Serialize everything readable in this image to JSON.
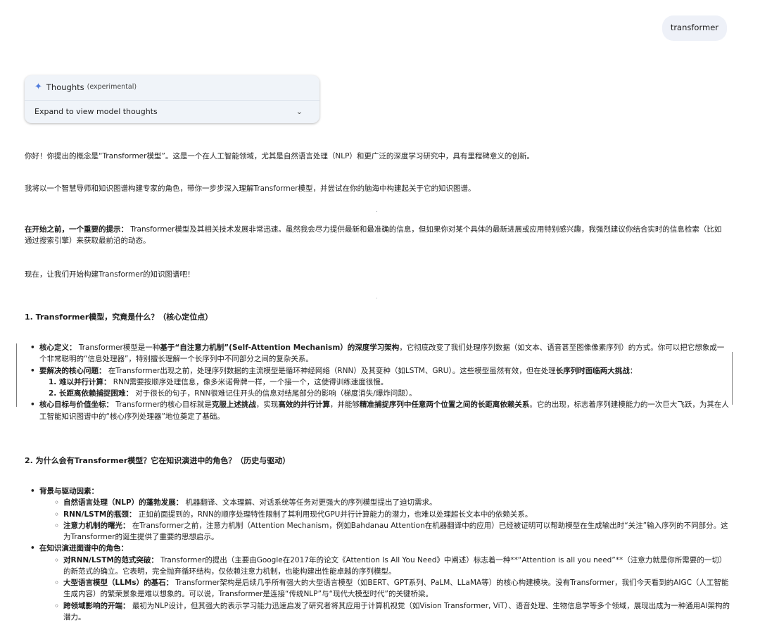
{
  "user_query": "transformer",
  "thoughts": {
    "title": "Thoughts",
    "tag": "(experimental)",
    "expand_label": "Expand to view model thoughts"
  },
  "response": {
    "p1": "你好！你提出的概念是“Transformer模型”。这是一个在人工智能领域，尤其是自然语言处理（NLP）和更广泛的深度学习研究中，具有里程碑意义的创新。",
    "p2": "我将以一个智慧导师和知识图谱构建专家的角色，带你一步步深入理解Transformer模型，并尝试在你的脑海中构建起关于它的知识图谱。",
    "p3_bold": "在开始之前，一个重要的提示：",
    "p3_text": " Transformer模型及其相关技术发展非常迅速。虽然我会尽力提供最新和最准确的信息，但如果你对某个具体的最新进展或应用特别感兴趣，我强烈建议你结合实时的信息检索（比如通过搜索引擎）来获取最前沿的动态。",
    "p4": "现在，让我们开始构建Transformer的知识图谱吧！",
    "section1": {
      "heading": "1. Transformer模型，究竟是什么？（核心定位点）",
      "b1_label": "核心定义：",
      "b1_t1": " Transformer模型是一种",
      "b1_bold2": "基于“自注意力机制”(Self-Attention Mechanism）的深度学习架构",
      "b1_t2": "，它彻底改变了我们处理序列数据（如文本、语音甚至图像像素序列）的方式。你可以把它想象成一个非常聪明的“信息处理器”，特别擅长理解一个长序列中不同部分之间的复杂关系。",
      "b2_label": "要解决的核心问题：",
      "b2_t1": " 在Transformer出现之前，处理序列数据的主流模型是循环神经网络（RNN）及其变种（如LSTM、GRU）。这些模型虽然有效，但在处理",
      "b2_bold2": "长序列时面临两大挑战",
      "b2_t2": "：",
      "n1_label": "1. 难以并行计算：",
      "n1_text": " RNN需要按顺序处理信息，像多米诺骨牌一样，一个接一个，这使得训练速度很慢。",
      "n2_label": "2. 长距离依赖捕捉困难：",
      "n2_text": " 对于很长的句子，RNN很难记住开头的信息对结尾部分的影响（梯度消失/爆炸问题）。",
      "b3_label": "核心目标与价值坐标：",
      "b3_t1": " Transformer的核心目标就是",
      "b3_bold2": "克服上述挑战",
      "b3_t2": "，实现",
      "b3_bold3": "高效的并行计算",
      "b3_t3": "，并能够",
      "b3_bold4": "精准捕捉序列中任意两个位置之间的长距离依赖关系",
      "b3_t4": "。它的出现，标志着序列建模能力的一次巨大飞跃，为其在人工智能知识图谱中的“核心序列处理器”地位奠定了基础。"
    },
    "section2": {
      "heading": "2. 为什么会有Transformer模型？它在知识演进中的角色？（历史与驱动）",
      "g1_label": "背景与驱动因素：",
      "s1_label": "自然语言处理（NLP）的蓬勃发展：",
      "s1_text": " 机器翻译、文本理解、对话系统等任务对更强大的序列模型提出了迫切需求。",
      "s2_label": "RNN/LSTM的瓶颈：",
      "s2_text": " 正如前面提到的，RNN的顺序处理特性限制了其利用现代GPU并行计算能力的潜力，也难以处理超长文本中的依赖关系。",
      "s3_label": "注意力机制的曙光：",
      "s3_text": " 在Transformer之前，注意力机制（Attention Mechanism，例如Bahdanau Attention在机器翻译中的应用）已经被证明可以帮助模型在生成输出时“关注”输入序列的不同部分。这为Transformer的诞生提供了重要的思想启示。",
      "g2_label": "在知识演进图谱中的角色：",
      "r1_label": "对RNN/LSTM的范式突破：",
      "r1_text": " Transformer的提出（主要由Google在2017年的论文《Attention Is All You Need》中阐述）标志着一种**“Attention is all you need”**（注意力就是你所需要的一切）的新范式的确立。它表明，完全抛弃循环结构，仅依赖注意力机制，也能构建出性能卓越的序列模型。",
      "r2_label": "大型语言模型（LLMs）的基石：",
      "r2_text": " Transformer架构是后续几乎所有强大的大型语言模型（如BERT、GPT系列、PaLM、LLaMA等）的核心构建模块。没有Transformer，我们今天看到的AIGC（人工智能生成内容）的繁荣景象是难以想象的。可以说，Transformer是连接“传统NLP”与“现代大模型时代”的关键桥梁。",
      "r3_label": "跨领域影响的开端：",
      "r3_text": " 最初为NLP设计，但其强大的表示学习能力迅速启发了研究者将其应用于计算机视觉（如Vision Transformer, ViT）、语音处理、生物信息学等多个领域，展现出成为一种通用AI架构的潜力。"
    }
  }
}
